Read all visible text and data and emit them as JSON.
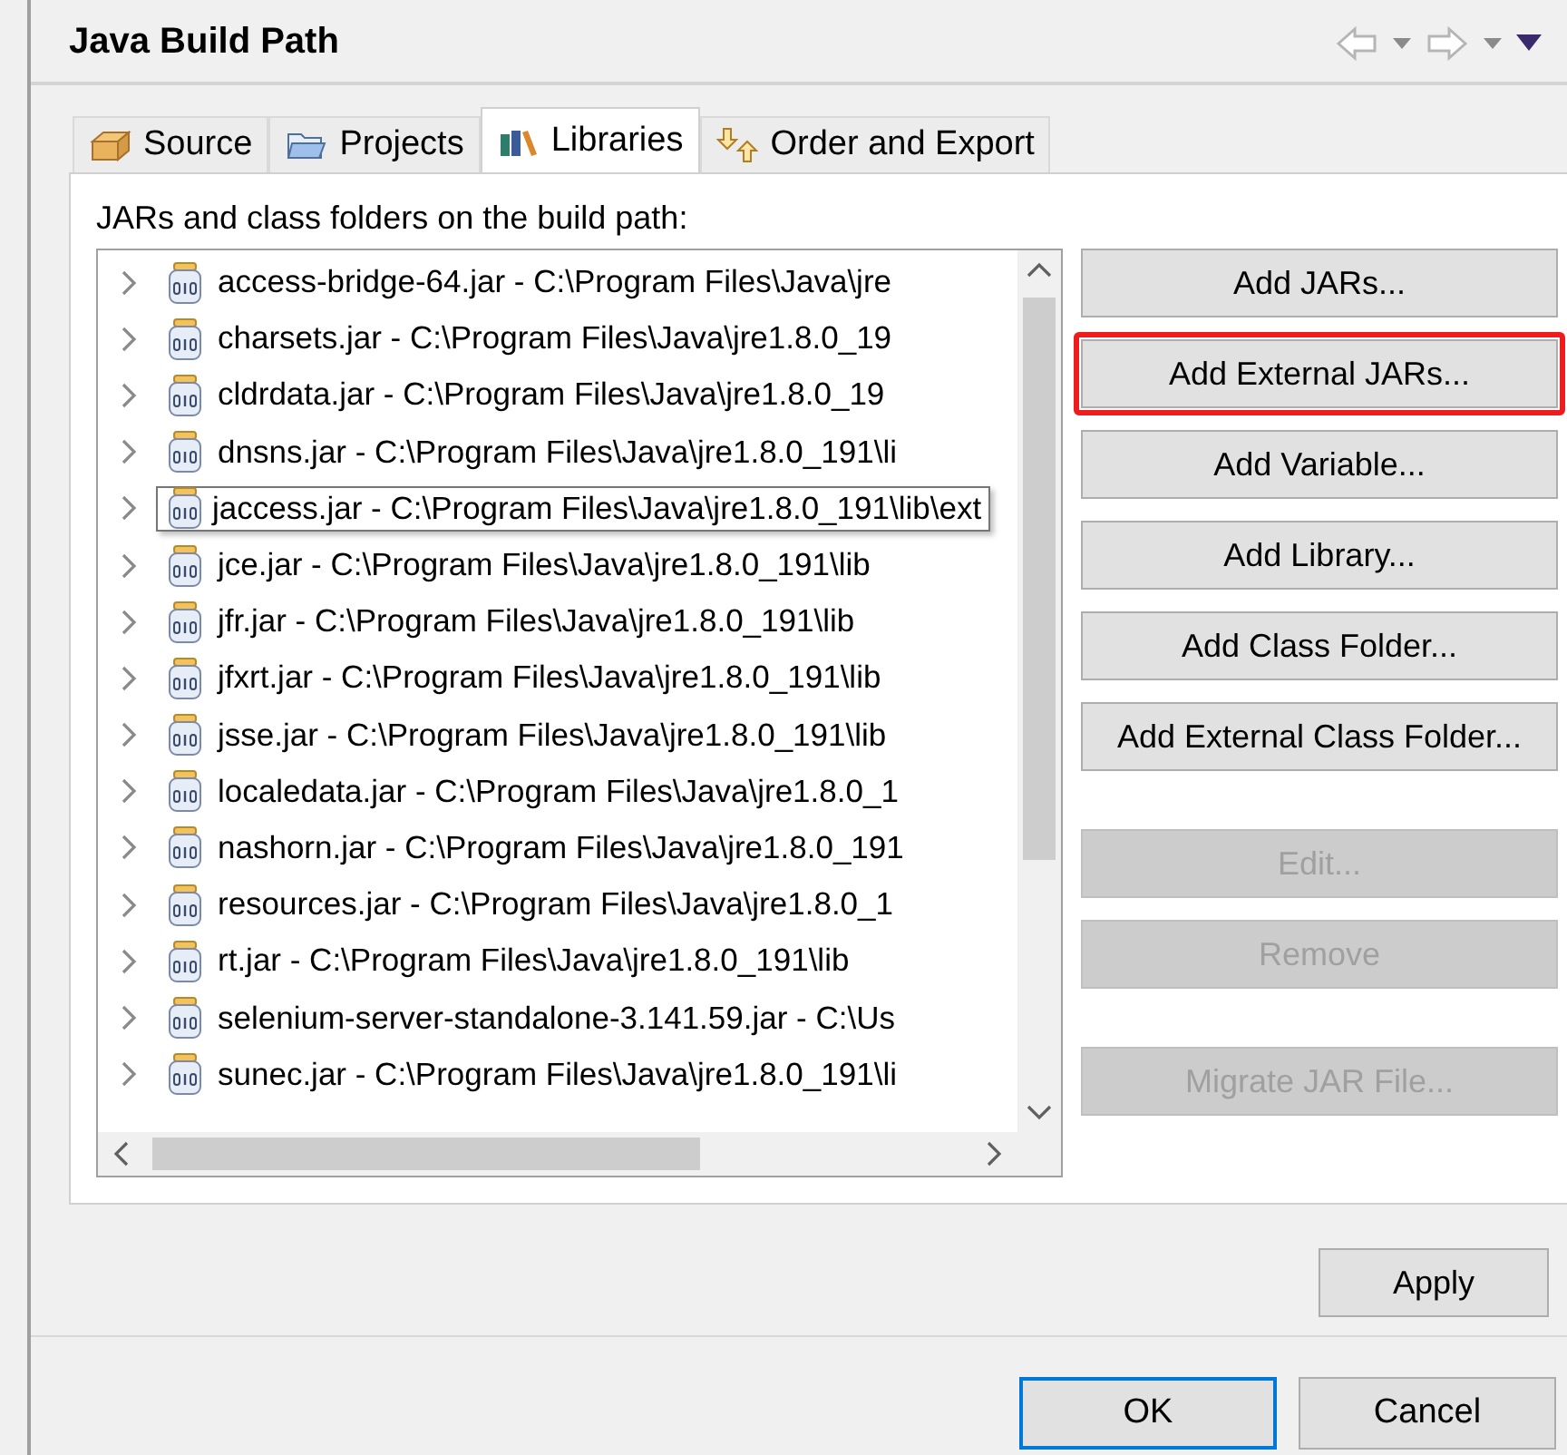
{
  "header": {
    "title": "Java Build Path"
  },
  "tabs": [
    {
      "label": "Source",
      "kind": "source",
      "selected": false
    },
    {
      "label": "Projects",
      "kind": "projects",
      "selected": false
    },
    {
      "label": "Libraries",
      "kind": "libraries",
      "selected": true
    },
    {
      "label": "Order and Export",
      "kind": "order",
      "selected": false
    }
  ],
  "libraries": {
    "label": "JARs and class folders on the build path:",
    "items": [
      {
        "text": "access-bridge-64.jar - C:\\Program Files\\Java\\jre",
        "hovered": false
      },
      {
        "text": "charsets.jar - C:\\Program Files\\Java\\jre1.8.0_19",
        "hovered": false
      },
      {
        "text": "cldrdata.jar - C:\\Program Files\\Java\\jre1.8.0_19",
        "hovered": false
      },
      {
        "text": "dnsns.jar - C:\\Program Files\\Java\\jre1.8.0_191\\li",
        "hovered": false
      },
      {
        "text": "jaccess.jar - C:\\Program Files\\Java\\jre1.8.0_191\\lib\\ext",
        "hovered": true
      },
      {
        "text": "jce.jar - C:\\Program Files\\Java\\jre1.8.0_191\\lib",
        "hovered": false
      },
      {
        "text": "jfr.jar - C:\\Program Files\\Java\\jre1.8.0_191\\lib",
        "hovered": false
      },
      {
        "text": "jfxrt.jar - C:\\Program Files\\Java\\jre1.8.0_191\\lib",
        "hovered": false
      },
      {
        "text": "jsse.jar - C:\\Program Files\\Java\\jre1.8.0_191\\lib",
        "hovered": false
      },
      {
        "text": "localedata.jar - C:\\Program Files\\Java\\jre1.8.0_1",
        "hovered": false
      },
      {
        "text": "nashorn.jar - C:\\Program Files\\Java\\jre1.8.0_191",
        "hovered": false
      },
      {
        "text": "resources.jar - C:\\Program Files\\Java\\jre1.8.0_1",
        "hovered": false
      },
      {
        "text": "rt.jar - C:\\Program Files\\Java\\jre1.8.0_191\\lib",
        "hovered": false
      },
      {
        "text": "selenium-server-standalone-3.141.59.jar - C:\\Us",
        "hovered": false
      },
      {
        "text": "sunec.jar - C:\\Program Files\\Java\\jre1.8.0_191\\li",
        "hovered": false
      }
    ]
  },
  "button_groups": [
    [
      {
        "label": "Add JARs...",
        "disabled": false,
        "highlighted": false
      },
      {
        "label": "Add External JARs...",
        "disabled": false,
        "highlighted": true
      },
      {
        "label": "Add Variable...",
        "disabled": false,
        "highlighted": false
      },
      {
        "label": "Add Library...",
        "disabled": false,
        "highlighted": false
      },
      {
        "label": "Add Class Folder...",
        "disabled": false,
        "highlighted": false
      },
      {
        "label": "Add External Class Folder...",
        "disabled": false,
        "highlighted": false
      }
    ],
    [
      {
        "label": "Edit...",
        "disabled": true,
        "highlighted": false
      },
      {
        "label": "Remove",
        "disabled": true,
        "highlighted": false
      }
    ],
    [
      {
        "label": "Migrate JAR File...",
        "disabled": true,
        "highlighted": false
      }
    ]
  ],
  "apply_button": "Apply",
  "dialog_buttons": [
    {
      "label": "OK",
      "default": true
    },
    {
      "label": "Cancel",
      "default": false
    }
  ]
}
